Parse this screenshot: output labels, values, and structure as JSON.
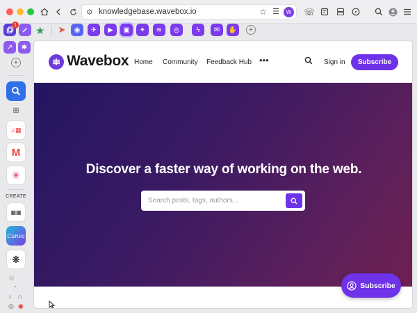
{
  "browser": {
    "url": "knowledgebase.wavebox.io",
    "profile_initial": "W",
    "group_badge_count": "1"
  },
  "sidebar": {
    "create_label": "CREATE",
    "canva_label": "Canva"
  },
  "site": {
    "brand": "Wavebox",
    "nav": [
      "Home",
      "Community",
      "Feedback Hub"
    ],
    "more_label": "•••",
    "signin_label": "Sign in",
    "subscribe_label": "Subscribe"
  },
  "hero": {
    "title": "Discover a faster way of working on the web.",
    "search_placeholder": "Search posts, tags, authors..."
  },
  "floating": {
    "subscribe_label": "Subscribe"
  },
  "colors": {
    "accent": "#6e32e8",
    "hero_start": "#241661",
    "hero_end": "#6f2150"
  }
}
